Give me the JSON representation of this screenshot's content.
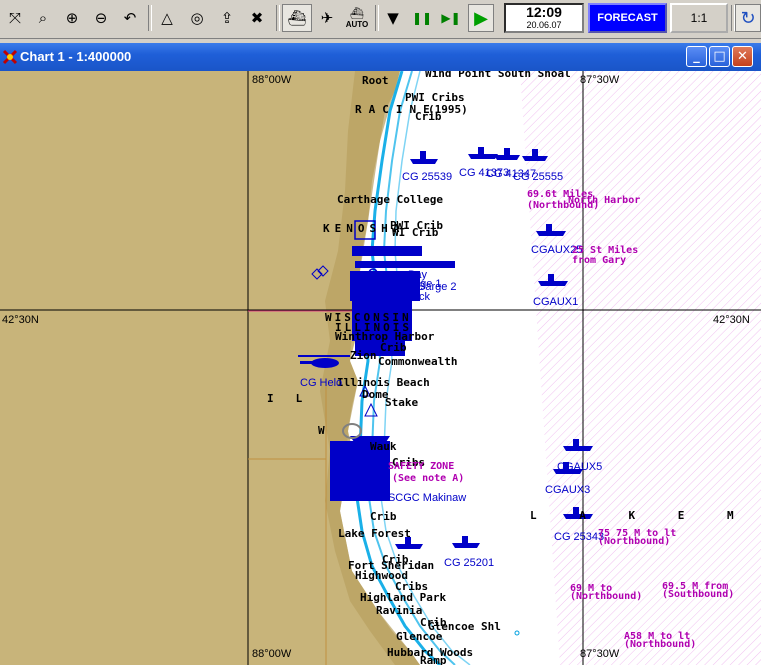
{
  "toolbar": {
    "tools": [
      {
        "name": "pan-icon",
        "glyph": "⤧"
      },
      {
        "name": "zoom-window-icon",
        "glyph": "⌕"
      },
      {
        "name": "zoom-in-icon",
        "glyph": "⊕"
      },
      {
        "name": "zoom-out-icon",
        "glyph": "⊖"
      },
      {
        "name": "undo-view-icon",
        "glyph": "↶"
      },
      {
        "name": "compass-icon",
        "glyph": "△"
      },
      {
        "name": "target-icon",
        "glyph": "◎"
      },
      {
        "name": "export-icon",
        "glyph": "⇪"
      },
      {
        "name": "clear-icon",
        "glyph": "✖"
      },
      {
        "name": "ship-mode-icon",
        "glyph": "⛴"
      },
      {
        "name": "aircraft-mode-icon",
        "glyph": "✈"
      }
    ],
    "auto_label": "AUTO",
    "playback": [
      {
        "name": "stop-icon",
        "glyph": "▼"
      },
      {
        "name": "pause-icon",
        "glyph": "❚❚"
      },
      {
        "name": "fast-forward-icon",
        "glyph": "▶❚"
      },
      {
        "name": "play-icon",
        "glyph": "▶"
      }
    ],
    "clock_time": "12:09",
    "clock_date": "20.06.07",
    "forecast_label": "FORECAST",
    "scale_label": "1:1",
    "refresh_glyph": "↻"
  },
  "window": {
    "title": "Chart 1 - 1:400000",
    "minimize_glyph": "_",
    "maximize_glyph": "□",
    "close_glyph": "✕"
  },
  "colors": {
    "land": "#c8b47a",
    "water": "#ffffff",
    "shallow": "#7fd4f4",
    "vessel": "#0000c8",
    "zone": "#b000b0"
  },
  "grid": {
    "lon_west": "88°00W",
    "lon_east": "87°30W",
    "lat_left": "42°30N",
    "lat_right": "42°30N"
  },
  "places": [
    "Root",
    "Wind Point South Shoal",
    "RACINE",
    "PWI Cribs",
    "(1995)",
    "Crib",
    "Carthage College",
    "KENOSHA",
    "PWI Crib",
    "WI Crib",
    "WISCONSIN",
    "ILLINOIS",
    "Winthrop Harbor",
    "Crib",
    "Zion",
    "Commonwealth",
    "Illinois Beach",
    "Dome",
    "Stake",
    "IL",
    "W",
    "Wauk",
    "Cribs",
    "Crib",
    "Lake Forest",
    "Crib",
    "Fort Sheridan",
    "Highwood",
    "Cribs",
    "Highland Park",
    "Ravinia",
    "Crib",
    "Glencoe Shl",
    "Glencoe",
    "Hubbard Woods",
    "Ramp"
  ],
  "vessels": [
    "CG 25539",
    "CG 41373",
    "CG 41347",
    "CG 25555",
    "CGAUX25",
    "CGAUX1",
    "CG Helo",
    "CGAUX5",
    "CGAUX3",
    "CG 25343",
    "CG 25201",
    "USCGC Makinaw",
    "Bay",
    "Barge 1",
    "Barge 2",
    "Dock"
  ],
  "zones": [
    "69.6t Miles",
    "(Northbound)",
    "North Harbor",
    "25 St Miles",
    "from Gary",
    "SAFETY ZONE",
    "(See note A)",
    "75 75 M to lt",
    "(Northbound)",
    "69 M to",
    "(Northbound)",
    "69.5 M from",
    "(Southbound)",
    "A58 M to lt",
    "(Northbound)"
  ],
  "lake_label": "L A K E   M I C"
}
